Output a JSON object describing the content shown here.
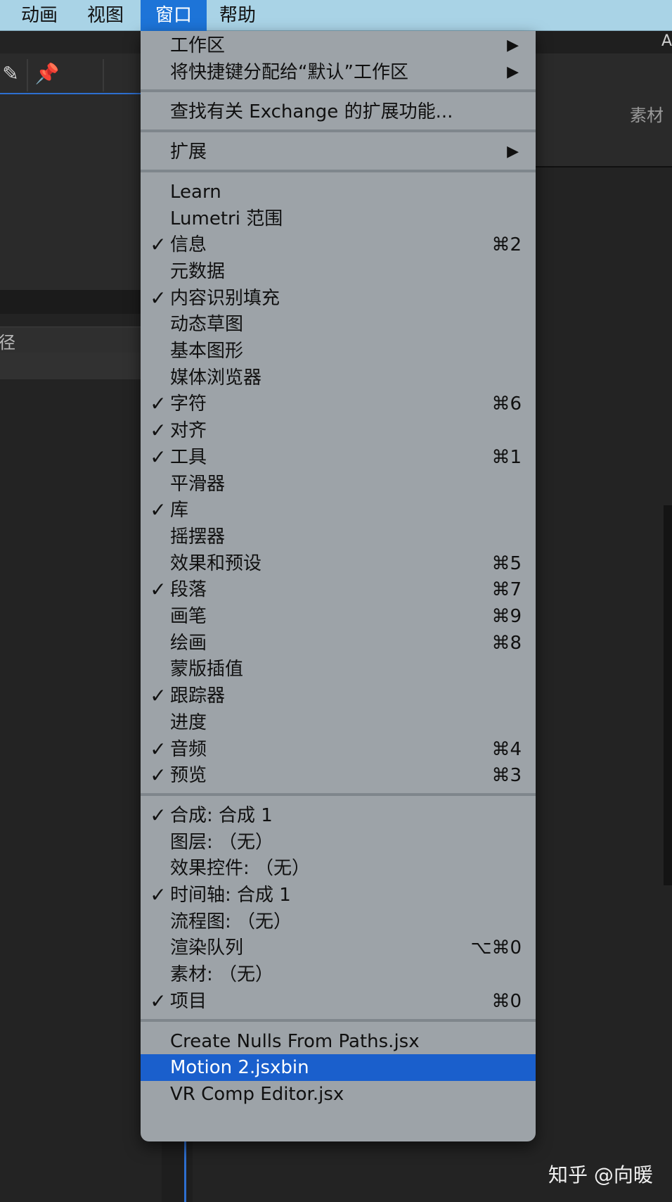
{
  "menubar": {
    "items": [
      "动画",
      "视图",
      "窗口",
      "帮助"
    ]
  },
  "background": {
    "right_panel_label": "素材",
    "left_strip_label": "径",
    "top_right_char": "A"
  },
  "menu": {
    "groups": [
      [
        {
          "label": "工作区",
          "submenu": true
        },
        {
          "label": "将快捷键分配给“默认”工作区",
          "submenu": true
        }
      ],
      [
        {
          "label": "查找有关 Exchange 的扩展功能..."
        }
      ],
      [
        {
          "label": "扩展",
          "submenu": true
        }
      ],
      [
        {
          "label": "Learn"
        },
        {
          "label": "Lumetri 范围"
        },
        {
          "label": "信息",
          "checked": true,
          "shortcut": "⌘2"
        },
        {
          "label": "元数据"
        },
        {
          "label": "内容识别填充",
          "checked": true
        },
        {
          "label": "动态草图"
        },
        {
          "label": "基本图形"
        },
        {
          "label": "媒体浏览器"
        },
        {
          "label": "字符",
          "checked": true,
          "shortcut": "⌘6"
        },
        {
          "label": "对齐",
          "checked": true
        },
        {
          "label": "工具",
          "checked": true,
          "shortcut": "⌘1"
        },
        {
          "label": "平滑器"
        },
        {
          "label": "库",
          "checked": true
        },
        {
          "label": "摇摆器"
        },
        {
          "label": "效果和预设",
          "shortcut": "⌘5"
        },
        {
          "label": "段落",
          "checked": true,
          "shortcut": "⌘7"
        },
        {
          "label": "画笔",
          "shortcut": "⌘9"
        },
        {
          "label": "绘画",
          "shortcut": "⌘8"
        },
        {
          "label": "蒙版插值"
        },
        {
          "label": "跟踪器",
          "checked": true
        },
        {
          "label": "进度"
        },
        {
          "label": "音频",
          "checked": true,
          "shortcut": "⌘4"
        },
        {
          "label": "预览",
          "checked": true,
          "shortcut": "⌘3"
        }
      ],
      [
        {
          "label": "合成: 合成 1",
          "checked": true
        },
        {
          "label": "图层: （无）"
        },
        {
          "label": "效果控件: （无）"
        },
        {
          "label": "时间轴: 合成 1",
          "checked": true
        },
        {
          "label": "流程图: （无）"
        },
        {
          "label": "渲染队列",
          "shortcut": "⌥⌘0"
        },
        {
          "label": "素材: （无）"
        },
        {
          "label": "项目",
          "checked": true,
          "shortcut": "⌘0"
        }
      ],
      [
        {
          "label": "Create Nulls From Paths.jsx"
        },
        {
          "label": "Motion 2.jsxbin",
          "highlighted": true
        },
        {
          "label": "VR Comp Editor.jsx"
        }
      ]
    ]
  },
  "watermark": "知乎 @向暖",
  "colors": {
    "menubar": "#a9d3e6",
    "menubar_active": "#1d74d8",
    "menu_bg": "#9da3a8",
    "highlight": "#1a5fcc",
    "app_bg": "#232323"
  },
  "icons": {
    "check": "✓",
    "submenu": "▶"
  }
}
